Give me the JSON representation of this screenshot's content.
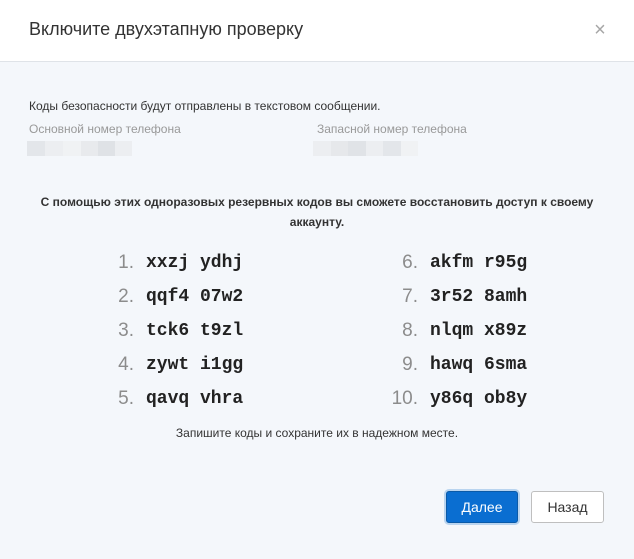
{
  "dialog": {
    "title": "Включите двухэтапную проверку",
    "close_symbol": "×",
    "info_text": "Коды безопасности будут отправлены в текстовом сообщении.",
    "primary_phone_label": "Основной номер телефона",
    "backup_phone_label": "Запасной номер телефона",
    "backup_codes_heading": "С помощью этих одноразовых резервных кодов вы сможете восстановить доступ к своему аккаунту.",
    "codes_left": [
      {
        "num": "1.",
        "code": "xxzj ydhj"
      },
      {
        "num": "2.",
        "code": "qqf4 07w2"
      },
      {
        "num": "3.",
        "code": "tck6 t9zl"
      },
      {
        "num": "4.",
        "code": "zywt i1gg"
      },
      {
        "num": "5.",
        "code": "qavq vhra"
      }
    ],
    "codes_right": [
      {
        "num": "6.",
        "code": "akfm r95g"
      },
      {
        "num": "7.",
        "code": "3r52 8amh"
      },
      {
        "num": "8.",
        "code": "nlqm x89z"
      },
      {
        "num": "9.",
        "code": "hawq 6sma"
      },
      {
        "num": "10.",
        "code": "y86q ob8y"
      }
    ],
    "save_note": "Запишите коды и сохраните их в надежном месте.",
    "next_button": "Далее",
    "back_button": "Назад"
  },
  "colors": {
    "accent": "#0a6ed1",
    "background": "#f4f7fb",
    "header_background": "#ffffff"
  }
}
